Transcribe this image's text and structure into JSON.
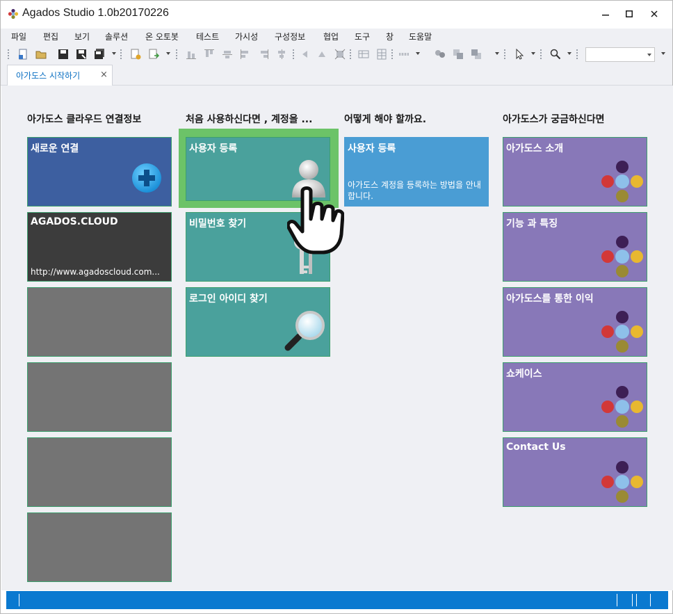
{
  "window": {
    "title": "Agados Studio 1.0b20170226",
    "buttons": {
      "minimize": "—",
      "maximize": "☐",
      "close": "✕"
    }
  },
  "menu": [
    "파일",
    "편집",
    "보기",
    "솔루션",
    "온 오토봇",
    "테스트",
    "가시성",
    "구성정보",
    "협업",
    "도구",
    "창",
    "도움말"
  ],
  "toolbar": {
    "combo_value": ""
  },
  "tab": {
    "label": "아가도스 시작하기",
    "close": "×"
  },
  "columns": [
    {
      "heading": "아가도스 클라우드 연결정보",
      "tiles": [
        {
          "label": "새로운 연결",
          "icon": "add-icon"
        },
        {
          "label": "AGADOS.CLOUD",
          "sub": "http://www.agadoscloud.com..."
        },
        {
          "label": ""
        },
        {
          "label": ""
        },
        {
          "label": ""
        },
        {
          "label": ""
        }
      ]
    },
    {
      "heading": "처음 사용하신다면 , 계정을 ...",
      "tiles": [
        {
          "label": "사용자 등록",
          "icon": "user-icon",
          "selected": true
        },
        {
          "label": "비밀번호 찾기",
          "icon": "keys-icon"
        },
        {
          "label": "로그인 아이디 찾기",
          "icon": "magnifier-icon"
        }
      ]
    },
    {
      "heading": "어떻게 해야 할까요.",
      "tiles": [
        {
          "label": "사용자 등록",
          "desc": "아가도스 계정을 등록하는 방법을 안내합니다."
        }
      ]
    },
    {
      "heading": "아가도스가 궁금하신다면",
      "tiles": [
        {
          "label": "아가도스 소개",
          "icon": "agados-logo-icon"
        },
        {
          "label": "기능 과 특징",
          "icon": "agados-logo-icon"
        },
        {
          "label": "아가도스를 통한 이익",
          "icon": "agados-logo-icon"
        },
        {
          "label": "쇼케이스",
          "icon": "agados-logo-icon"
        },
        {
          "label": "Contact Us",
          "icon": "agados-logo-icon"
        }
      ]
    }
  ],
  "colors": {
    "accent": "#0a79d0",
    "tile_blue": "#3d5fa0",
    "tile_dark": "#3c3c3c",
    "tile_gray": "#747474",
    "tile_teal": "#4aa19c",
    "tile_lightblue": "#4a9dd4",
    "tile_purple": "#8878b8",
    "selection": "#6cc368"
  }
}
